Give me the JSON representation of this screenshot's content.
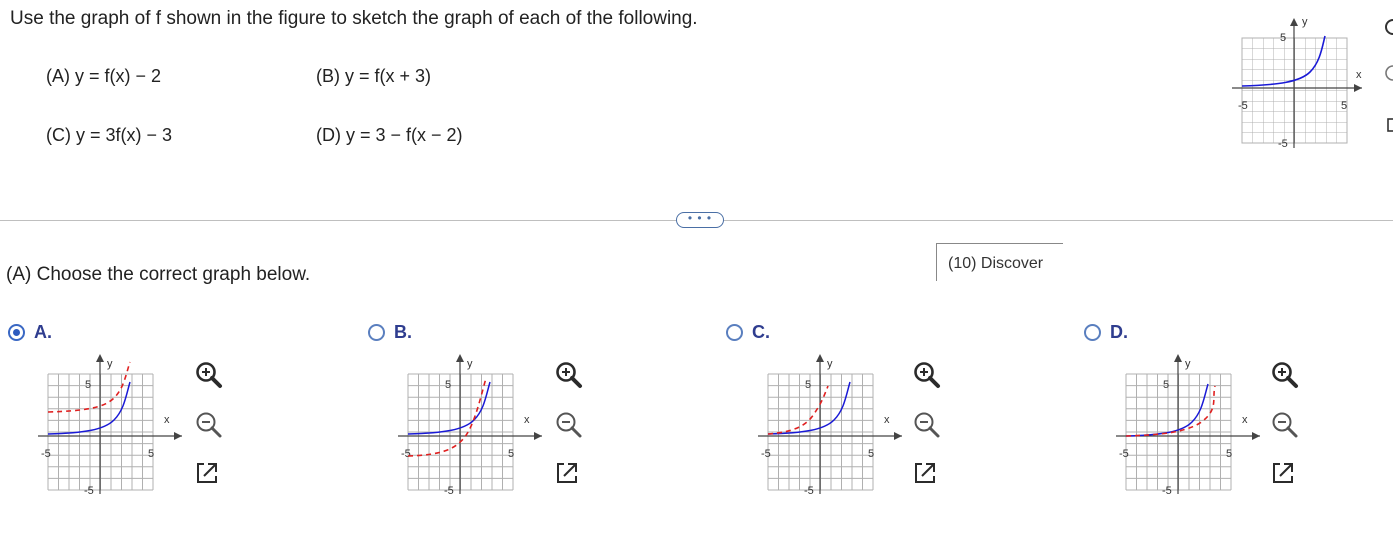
{
  "question": {
    "text": "Use the graph of f shown in the figure to sketch the graph of each of the following.",
    "parts": [
      {
        "id": "A",
        "text": "(A) y = f(x) − 2"
      },
      {
        "id": "B",
        "text": "(B) y = f(x + 3)"
      },
      {
        "id": "C",
        "text": "(C) y = 3f(x) − 3"
      },
      {
        "id": "D",
        "text": "(D) y = 3 − f(x − 2)"
      }
    ]
  },
  "reference_graph": {
    "x_label": "x",
    "y_label": "y",
    "tick_pos": "5",
    "tick_neg": "-5",
    "curve_color": "#1a1ad6"
  },
  "more_button": {
    "label": "• • •"
  },
  "discover": {
    "label": "(10) Discover"
  },
  "answer": {
    "prompt": "(A) Choose the correct graph below.",
    "selected": "A",
    "options": [
      {
        "id": "A",
        "label": "A.",
        "selected": true
      },
      {
        "id": "B",
        "label": "B.",
        "selected": false
      },
      {
        "id": "C",
        "label": "C.",
        "selected": false
      },
      {
        "id": "D",
        "label": "D.",
        "selected": false
      }
    ]
  },
  "graph_labels": {
    "x": "x",
    "y": "y",
    "tick_pos": "5",
    "tick_neg": "-5"
  },
  "colors": {
    "accent": "#2d5bbf",
    "option_label": "#2f3d8f",
    "solid_curve": "#1a1ad6",
    "dashed_curve": "#e02020",
    "grid": "#b0b0b0"
  },
  "icons": [
    "zoom-in-icon",
    "zoom-out-icon",
    "open-new-window-icon"
  ]
}
